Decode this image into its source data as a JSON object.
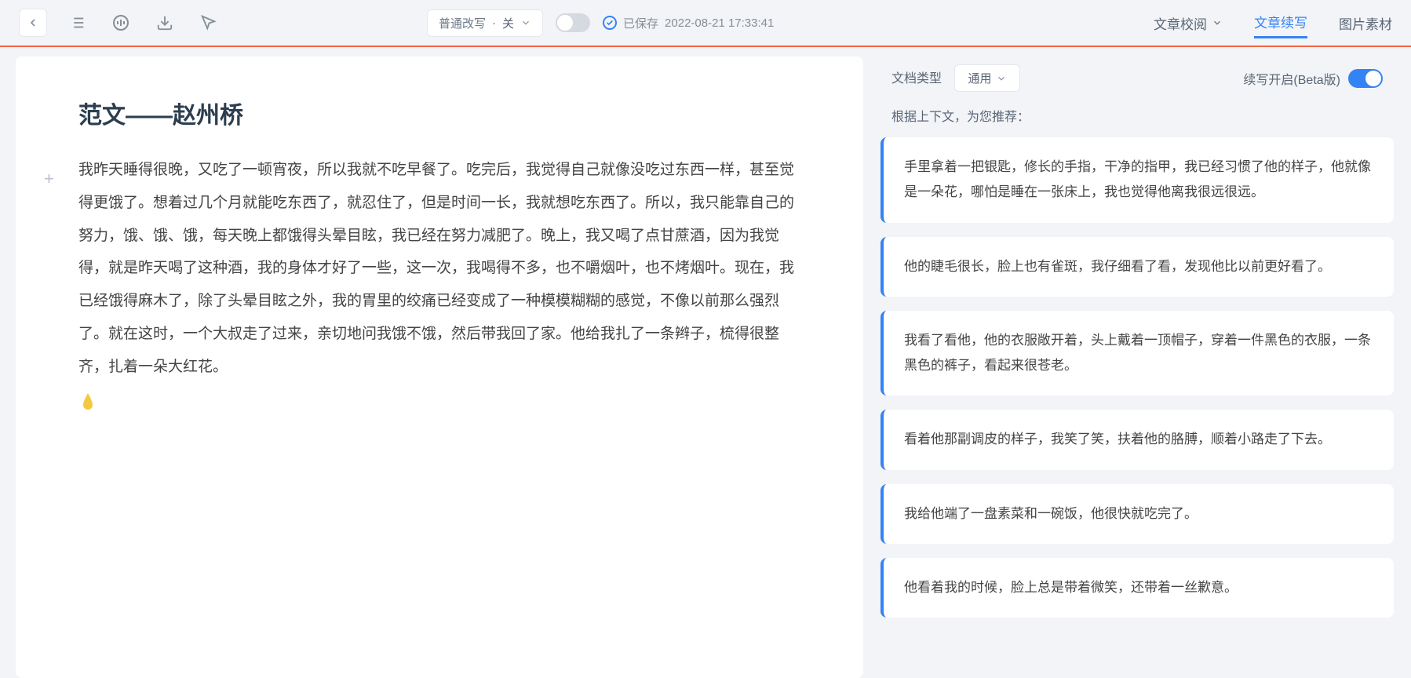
{
  "toolbar": {
    "rewrite_label": "普通改写",
    "rewrite_status": "关",
    "saved_label": "已保存",
    "saved_time": "2022-08-21 17:33:41"
  },
  "top_tabs": {
    "review": "文章校阅",
    "continuation": "文章续写",
    "image": "图片素材"
  },
  "document": {
    "title": "范文——赵州桥",
    "body": "我昨天睡得很晚，又吃了一顿宵夜，所以我就不吃早餐了。吃完后，我觉得自己就像没吃过东西一样，甚至觉得更饿了。想着过几个月就能吃东西了，就忍住了，但是时间一长，我就想吃东西了。所以，我只能靠自己的努力，饿、饿、饿，每天晚上都饿得头晕目眩，我已经在努力减肥了。晚上，我又喝了点甘蔗酒，因为我觉得，就是昨天喝了这种酒，我的身体才好了一些，这一次，我喝得不多，也不嚼烟叶，也不烤烟叶。现在，我已经饿得麻木了，除了头晕目眩之外，我的胃里的绞痛已经变成了一种模模糊糊的感觉，不像以前那么强烈了。就在这时，一个大叔走了过来，亲切地问我饿不饿，然后带我回了家。他给我扎了一条辫子，梳得很整齐，扎着一朵大红花。"
  },
  "right_panel": {
    "doc_type_label": "文档类型",
    "doc_type_value": "通用",
    "continuation_label": "续写开启(Beta版)",
    "recommendation_label": "根据上下文，为您推荐："
  },
  "suggestions": [
    "手里拿着一把银匙，修长的手指，干净的指甲，我已经习惯了他的样子，他就像是一朵花，哪怕是睡在一张床上，我也觉得他离我很远很远。",
    "他的睫毛很长，脸上也有雀斑，我仔细看了看，发现他比以前更好看了。",
    "我看了看他，他的衣服敞开着，头上戴着一顶帽子，穿着一件黑色的衣服，一条黑色的裤子，看起来很苍老。",
    "看着他那副调皮的样子，我笑了笑，扶着他的胳膊，顺着小路走了下去。",
    "我给他端了一盘素菜和一碗饭，他很快就吃完了。",
    "他看着我的时候，脸上总是带着微笑，还带着一丝歉意。"
  ]
}
